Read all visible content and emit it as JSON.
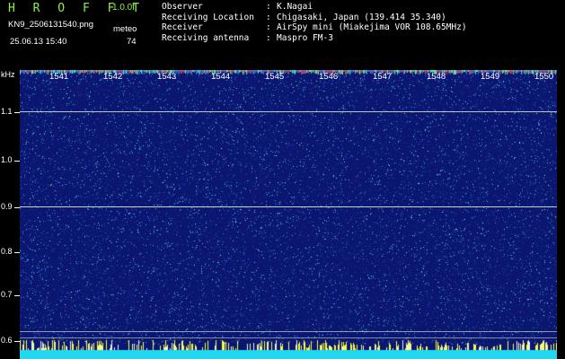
{
  "header": {
    "app_name": "H R O F F T",
    "version": "1.0.0f",
    "filename": "KN9_2506131540.png",
    "meteor_label": "meteo",
    "datetime": "25.06.13 15:40",
    "meteor_count": "74",
    "info": [
      {
        "key": "Observer",
        "sep": ":",
        "value": "K.Nagai"
      },
      {
        "key": "Receiving Location",
        "sep": ":",
        "value": "Chigasaki, Japan (139.414 35.340)"
      },
      {
        "key": "Receiver",
        "sep": ":",
        "value": "AirSpy mini (Miakejima VOR 108.65MHz)"
      },
      {
        "key": "Receiving antenna",
        "sep": ":",
        "value": "Maspro FM-3"
      }
    ]
  },
  "axis": {
    "unit": "kHz",
    "y_labels": [
      "1.1",
      "1.0",
      "0.9",
      "0.8",
      "0.7",
      "0.6"
    ],
    "time_labels": [
      "1541",
      "1542",
      "1543",
      "1544",
      "1545",
      "1546",
      "1547",
      "1548",
      "1549",
      "1550"
    ]
  },
  "colors": {
    "background": "#0a1670",
    "noise": "#3fb8d8",
    "line_white": "#e8f0d0",
    "bottom_band": "#22d8f0",
    "spike": "#ffff40"
  }
}
